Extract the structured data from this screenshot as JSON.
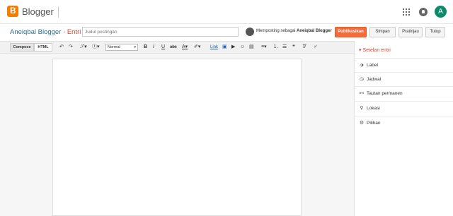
{
  "app": {
    "brand": "Blogger",
    "avatar_letter": "A"
  },
  "post": {
    "blog_name": "Aneiqbal Blogger",
    "separator": "·",
    "entry_label": "Entri",
    "title_placeholder": "Judul postingan",
    "posting_as_prefix": "Memposting sebagai",
    "posting_as_user": "Aneiqbal Blogger",
    "buttons": {
      "publish": "Publikasikan",
      "save": "Simpan",
      "preview": "Pratinjau",
      "close": "Tutup"
    }
  },
  "toolbar": {
    "compose": "Compose",
    "html": "HTML",
    "format_select": "Normal",
    "link": "Link"
  },
  "sidebar": {
    "header": "Setelan entri",
    "items": [
      {
        "label": "Label",
        "icon": "tag-icon"
      },
      {
        "label": "Jadwal",
        "icon": "clock-icon"
      },
      {
        "label": "Tautan permanen",
        "icon": "link-icon"
      },
      {
        "label": "Lokasi",
        "icon": "location-pin-icon"
      },
      {
        "label": "Pilihan",
        "icon": "gear-icon"
      }
    ]
  },
  "colors": {
    "accent": "#f46c3b",
    "blog_name": "#2a6f8f",
    "entry": "#d9452e",
    "logo": "#f57d00"
  }
}
